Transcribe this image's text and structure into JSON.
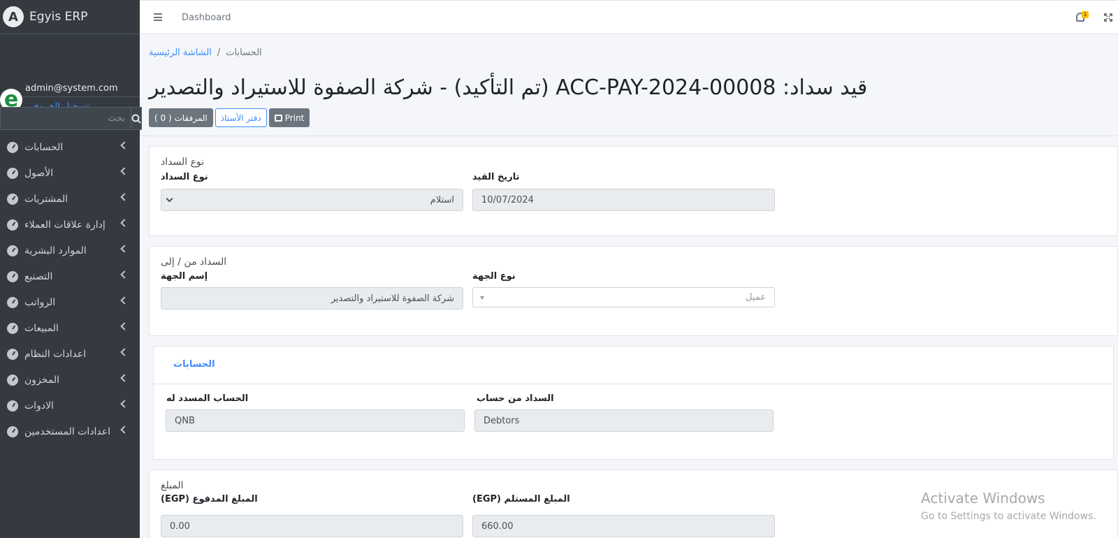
{
  "app": {
    "name": "Egyis ERP"
  },
  "user": {
    "email": "admin@system.com",
    "logout": "تسجيل الخروج",
    "avatar_letter": "e"
  },
  "search": {
    "placeholder": "بحث"
  },
  "sidebar": {
    "items": [
      {
        "label": "الحسابات"
      },
      {
        "label": "الأصول"
      },
      {
        "label": "المشتريات"
      },
      {
        "label": "إدارة علاقات العملاء"
      },
      {
        "label": "الموارد البشرية"
      },
      {
        "label": "التصنيع"
      },
      {
        "label": "الرواتب"
      },
      {
        "label": "المبيعات"
      },
      {
        "label": "اعدادات النظام"
      },
      {
        "label": "المخزون"
      },
      {
        "label": "الادوات"
      },
      {
        "label": "اعدادات المستخدمين"
      }
    ]
  },
  "topbar": {
    "dashboard": "Dashboard",
    "notification_count": "1"
  },
  "breadcrumb": {
    "home": "الشاشة الرئيسية",
    "separator": "/",
    "current": "الحسابات"
  },
  "page": {
    "title": "قيد سداد: ACC-PAY-2024-00008 (تم التأكيد) - شركة الصفوة للاستيراد والتصدير"
  },
  "actions": {
    "attachments": "المرفقات ( 0 )",
    "ledger": "دفتر الأستاذ",
    "print": "Print"
  },
  "payment_type_section": {
    "title": "نوع السداد",
    "payment_type_label": "نوع السداد",
    "payment_type_value": "استلام",
    "posting_date_label": "تاريخ القيد",
    "posting_date_value": "10/07/2024"
  },
  "party_section": {
    "title": "السداد من / إلى",
    "party_name_label": "إسم الجهة",
    "party_name_value": "شركة الصفوة للاستيراد والتصدير",
    "party_type_label": "نوع الجهة",
    "party_type_value": "عميل"
  },
  "accounts_section": {
    "tab": "الحسابات",
    "paid_to_label": "الحساب المسدد له",
    "paid_to_value": "QNB",
    "paid_from_label": "السداد من حساب",
    "paid_from_value": "Debtors"
  },
  "amount_section": {
    "title": "المبلغ",
    "paid_amount_label": "المبلغ المدفوع (EGP)",
    "paid_amount_value": "0.00",
    "received_amount_label": "المبلغ المستلم (EGP)",
    "received_amount_value": "660.00"
  },
  "watermark": {
    "line1": "Activate Windows",
    "line2": "Go to Settings to activate Windows."
  }
}
